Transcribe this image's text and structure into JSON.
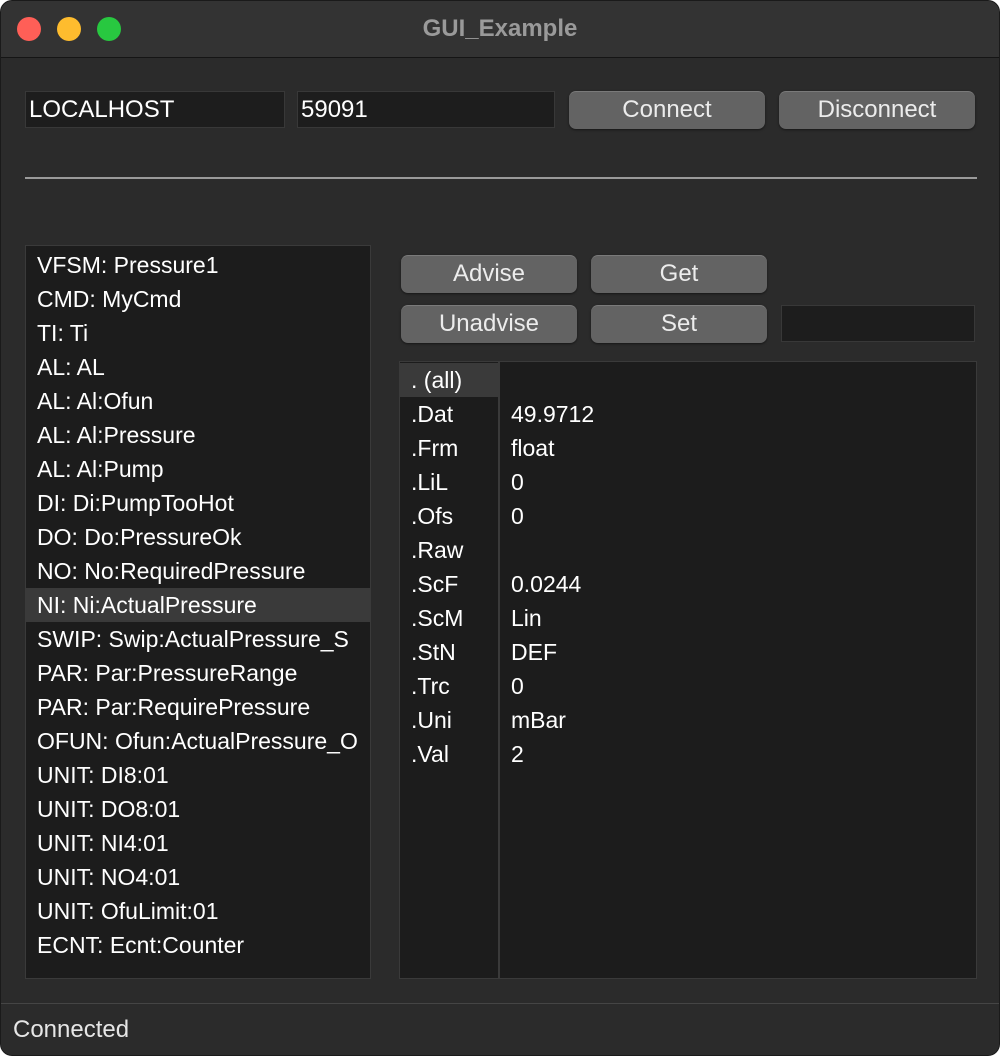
{
  "window": {
    "title": "GUI_Example"
  },
  "connection": {
    "host": "LOCALHOST",
    "port": "59091",
    "connect_label": "Connect",
    "disconnect_label": "Disconnect"
  },
  "actions": {
    "advise_label": "Advise",
    "get_label": "Get",
    "unadvise_label": "Unadvise",
    "set_label": "Set",
    "set_value": ""
  },
  "items": [
    "VFSM: Pressure1",
    "CMD: MyCmd",
    "TI: Ti",
    "AL: AL",
    "AL: Al:Ofun",
    "AL: Al:Pressure",
    "AL: Al:Pump",
    "DI: Di:PumpTooHot",
    "DO: Do:PressureOk",
    "NO: No:RequiredPressure",
    "NI: Ni:ActualPressure",
    "SWIP: Swip:ActualPressure_S",
    "PAR: Par:PressureRange",
    "PAR: Par:RequirePressure",
    "OFUN: Ofun:ActualPressure_O",
    "UNIT: DI8:01",
    "UNIT: DO8:01",
    "UNIT: NI4:01",
    "UNIT: NO4:01",
    "UNIT: OfuLimit:01",
    "ECNT: Ecnt:Counter"
  ],
  "selected_item": "NI: Ni:ActualPressure",
  "properties": [
    {
      "key": ". (all)",
      "value": ""
    },
    {
      "key": ".Dat",
      "value": "49.9712"
    },
    {
      "key": ".Frm",
      "value": "float"
    },
    {
      "key": ".LiL",
      "value": "0"
    },
    {
      "key": ".Ofs",
      "value": "0"
    },
    {
      "key": ".Raw",
      "value": ""
    },
    {
      "key": ".ScF",
      "value": "0.0244"
    },
    {
      "key": ".ScM",
      "value": "Lin"
    },
    {
      "key": ".StN",
      "value": "DEF"
    },
    {
      "key": ".Trc",
      "value": "0"
    },
    {
      "key": ".Uni",
      "value": "mBar"
    },
    {
      "key": ".Val",
      "value": "2"
    }
  ],
  "selected_property": ". (all)",
  "status": {
    "text": "Connected"
  },
  "colors": {
    "window_bg": "#2b2b2b",
    "button_bg": "#636363",
    "selection_bg": "#3a3a3a",
    "close": "#ff5f57",
    "minimize": "#febc2e",
    "maximize": "#28c840"
  }
}
